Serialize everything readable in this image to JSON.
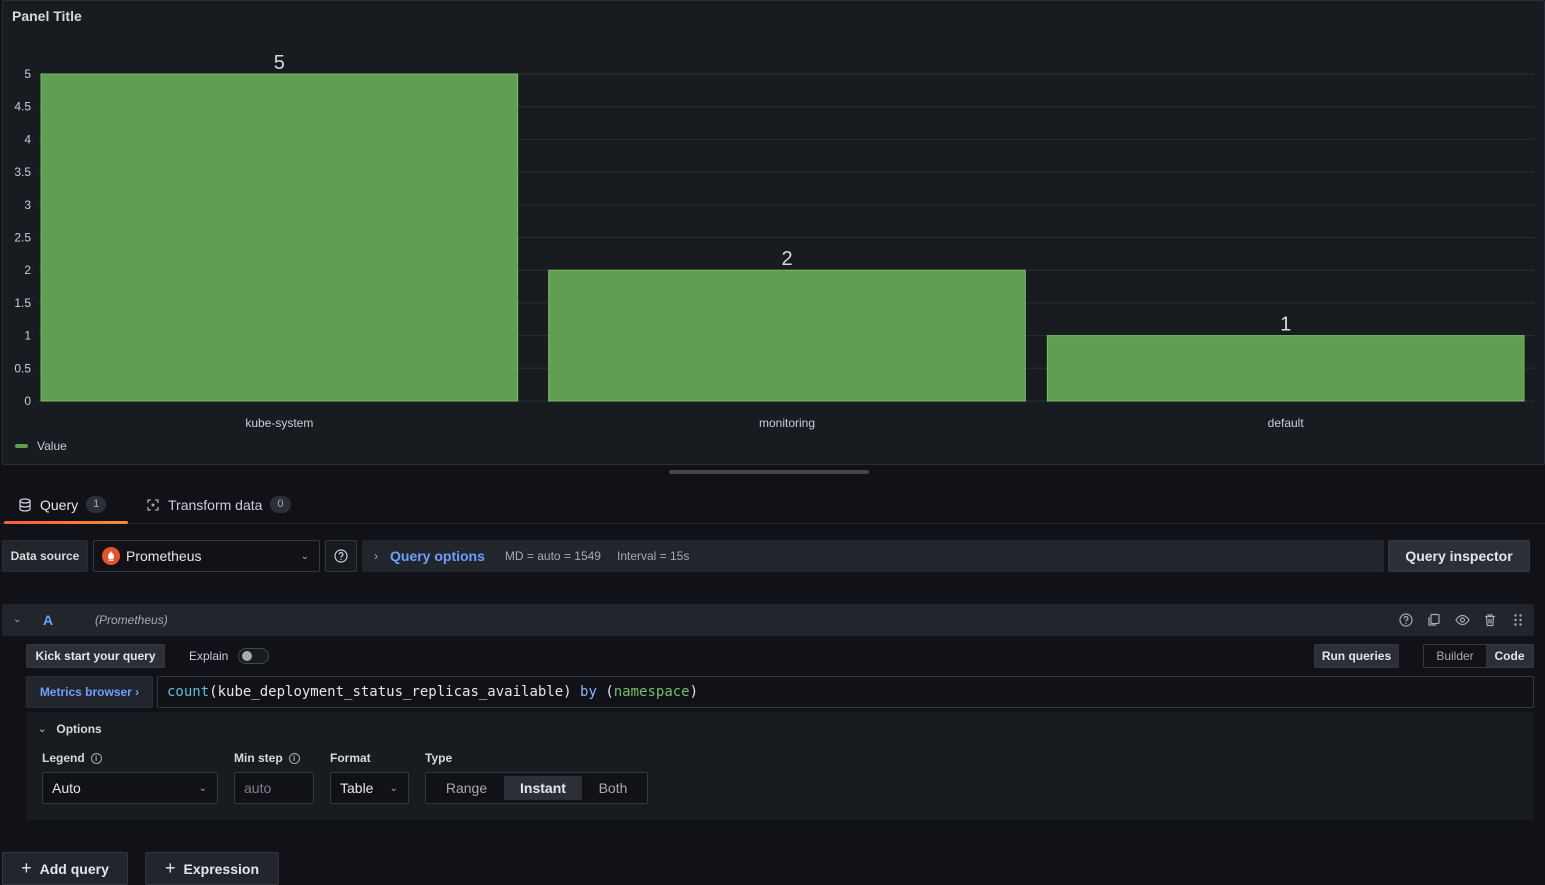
{
  "panel": {
    "title": "Panel Title"
  },
  "chart_data": {
    "type": "bar",
    "title": "Panel Title",
    "categories": [
      "kube-system",
      "monitoring",
      "default"
    ],
    "series": [
      {
        "name": "Value",
        "values": [
          5,
          2,
          1
        ],
        "color": "#629e51"
      }
    ],
    "ylim": [
      0,
      5
    ],
    "yticks": [
      "0",
      "0.5",
      "1",
      "1.5",
      "2",
      "2.5",
      "3",
      "3.5",
      "4",
      "4.5",
      "5"
    ],
    "grid": true,
    "legend": "bottom-left"
  },
  "tabs": [
    {
      "label": "Query",
      "count": "1",
      "icon": "database-icon"
    },
    {
      "label": "Transform data",
      "count": "0",
      "icon": "transform-icon"
    }
  ],
  "datasource": {
    "label": "Data source",
    "selected": "Prometheus",
    "query_options_label": "Query options",
    "md": "MD = auto = 1549",
    "interval": "Interval = 15s",
    "inspector_label": "Query inspector"
  },
  "query": {
    "ref_id": "A",
    "datasource_hint": "(Prometheus)",
    "kickstart_label": "Kick start your query",
    "explain_label": "Explain",
    "run_label": "Run queries",
    "mode_builder": "Builder",
    "mode_code": "Code",
    "metrics_browser_label": "Metrics browser ›",
    "expr_fn": "count",
    "expr_inner": "(kube_deployment_status_replicas_available) ",
    "expr_by": "by",
    "expr_paren_open": " (",
    "expr_label": "namespace",
    "expr_paren_close": ")"
  },
  "options": {
    "title": "Options",
    "legend_label": "Legend",
    "legend_value": "Auto",
    "minstep_label": "Min step",
    "minstep_placeholder": "auto",
    "format_label": "Format",
    "format_value": "Table",
    "type_label": "Type",
    "type_options": [
      "Range",
      "Instant",
      "Both"
    ],
    "type_selected": "Instant"
  },
  "footer": {
    "add_query": "Add query",
    "expression": "Expression"
  }
}
